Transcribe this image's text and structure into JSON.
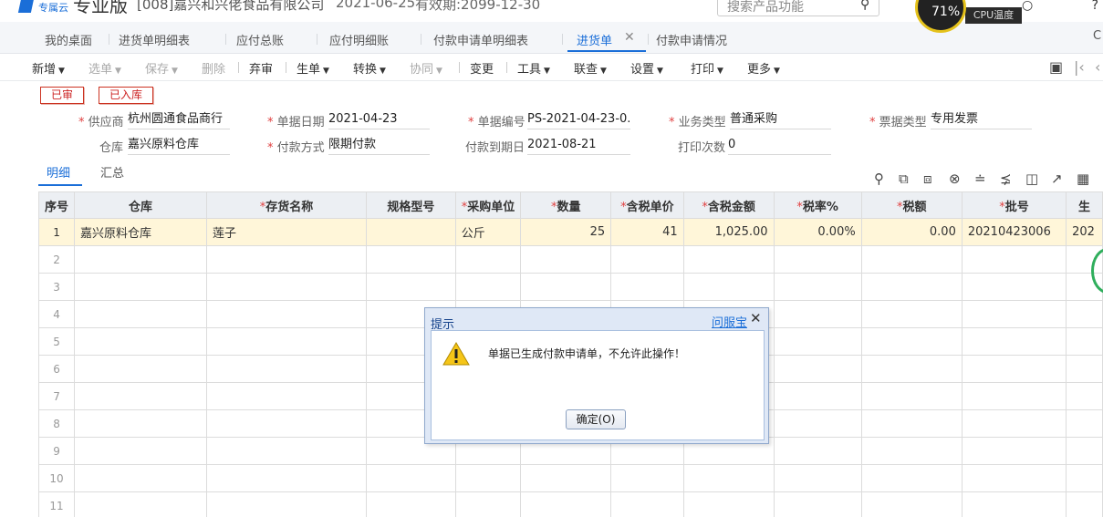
{
  "topbar": {
    "brand": "专属云",
    "product": "专业版",
    "company": "[008]嘉兴和兴佬食品有限公司",
    "date": "2021-06-25",
    "valid": "有效期:2099-12-30",
    "search_placeholder": "搜索产品功能",
    "cpu_value": "71%",
    "cpu_label": "CPU温度"
  },
  "tabs": [
    {
      "label": "我的桌面"
    },
    {
      "label": "进货单明细表"
    },
    {
      "label": "应付总账"
    },
    {
      "label": "应付明细账"
    },
    {
      "label": "付款申请单明细表"
    },
    {
      "label": "进货单",
      "active": true
    },
    {
      "label": "付款申请情况"
    }
  ],
  "toolbar": {
    "new": "新增",
    "select": "选单",
    "save": "保存",
    "delete": "删除",
    "unaudit": "弃审",
    "generate": "生单",
    "convert": "转换",
    "collab": "协同",
    "change": "变更",
    "tools": "工具",
    "query": "联查",
    "settings": "设置",
    "print": "打印",
    "more": "更多"
  },
  "status": {
    "audited": "已审",
    "stocked": "已入库"
  },
  "form": {
    "supplier_label": "供应商",
    "supplier": "杭州圆通食品商行",
    "date_label": "单据日期",
    "date": "2021-04-23",
    "code_label": "单据编号",
    "code": "PS-2021-04-23-0...",
    "biztype_label": "业务类型",
    "biztype": "普通采购",
    "invoice_label": "票据类型",
    "invoice": "专用发票",
    "warehouse_label": "仓库",
    "warehouse": "嘉兴原料仓库",
    "paymethod_label": "付款方式",
    "paymethod": "限期付款",
    "duedate_label": "付款到期日",
    "duedate": "2021-08-21",
    "printcount_label": "打印次数",
    "printcount": "0"
  },
  "subtabs": {
    "detail": "明细",
    "summary": "汇总"
  },
  "grid": {
    "headers": {
      "seq": "序号",
      "warehouse": "仓库",
      "item": "存货名称",
      "spec": "规格型号",
      "unit": "采购单位",
      "qty": "数量",
      "price": "含税单价",
      "amount": "含税金额",
      "rate": "税率%",
      "tax": "税额",
      "batch": "批号",
      "prod": "生"
    },
    "rows": [
      {
        "seq": "1",
        "warehouse": "嘉兴原料仓库",
        "item": "莲子",
        "spec": "",
        "unit": "公斤",
        "qty": "25",
        "price": "41",
        "amount": "1,025.00",
        "rate": "0.00%",
        "tax": "0.00",
        "batch": "20210423006",
        "prod": "202"
      }
    ],
    "empty_rows": [
      "2",
      "3",
      "4",
      "5",
      "6",
      "7",
      "8",
      "9",
      "10",
      "11"
    ]
  },
  "dialog": {
    "title": "提示",
    "help": "问服宝",
    "message": "单据已生成付款申请单，不允许此操作！",
    "ok": "确定(O)"
  }
}
